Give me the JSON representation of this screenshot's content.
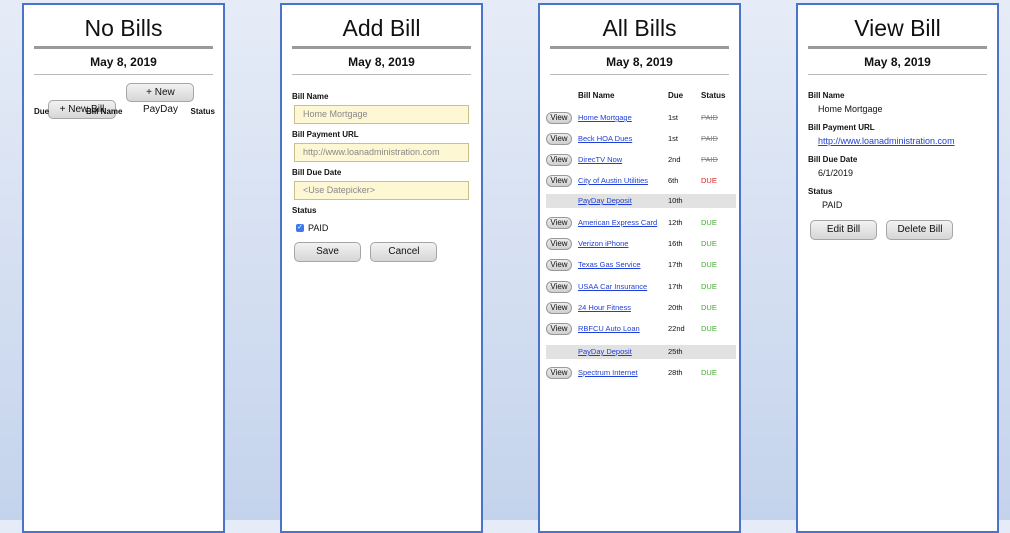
{
  "p1": {
    "title": "No Bills",
    "date": "May 8, 2019",
    "new_bill": "+ New Bill",
    "new_payday": "+ New PayDay",
    "cols": {
      "due": "Due",
      "name": "Bill Name",
      "status": "Status"
    }
  },
  "p2": {
    "title": "Add Bill",
    "date": "May 8, 2019",
    "name_label": "Bill Name",
    "name_placeholder": "Home Mortgage",
    "url_label": "Bill Payment URL",
    "url_placeholder": "http://www.loanadministration.com",
    "due_label": "Bill Due Date",
    "due_placeholder": "<Use Datepicker>",
    "status_label": "Status",
    "paid_label": "PAID",
    "paid_checked": true,
    "save": "Save",
    "cancel": "Cancel"
  },
  "p3": {
    "title": "All Bills",
    "date": "May 8, 2019",
    "cols": {
      "name": "Bill Name",
      "due": "Due",
      "status": "Status"
    },
    "view_label": "View",
    "rows": [
      {
        "name": "Home Mortgage",
        "due": "1st",
        "status": "PAID",
        "kind": "bill",
        "style": "paid"
      },
      {
        "name": "Beck HOA Dues",
        "due": "1st",
        "status": "PAID",
        "kind": "bill",
        "style": "paid"
      },
      {
        "name": "DirecTV Now",
        "due": "2nd",
        "status": "PAID",
        "kind": "bill",
        "style": "paid"
      },
      {
        "name": "City of Austin Utilities",
        "due": "6th",
        "status": "DUE",
        "kind": "bill",
        "style": "due-red"
      },
      {
        "name": "PayDay Deposit",
        "due": "10th",
        "status": "",
        "kind": "payday",
        "style": ""
      },
      {
        "name": "American Express Card",
        "due": "12th",
        "status": "DUE",
        "kind": "bill",
        "style": "due-green"
      },
      {
        "name": "Verizon iPhone",
        "due": "16th",
        "status": "DUE",
        "kind": "bill",
        "style": "due-green"
      },
      {
        "name": "Texas Gas Service",
        "due": "17th",
        "status": "DUE",
        "kind": "bill",
        "style": "due-green"
      },
      {
        "name": "USAA Car Insurance",
        "due": "17th",
        "status": "DUE",
        "kind": "bill",
        "style": "due-green"
      },
      {
        "name": "24 Hour Fitness",
        "due": "20th",
        "status": "DUE",
        "kind": "bill",
        "style": "due-green"
      },
      {
        "name": "RBFCU Auto Loan",
        "due": "22nd",
        "status": "DUE",
        "kind": "bill",
        "style": "due-green"
      },
      {
        "name": "PayDay Deposit",
        "due": "25th",
        "status": "",
        "kind": "payday",
        "style": ""
      },
      {
        "name": "Spectrum Internet",
        "due": "28th",
        "status": "DUE",
        "kind": "bill",
        "style": "due-green"
      }
    ]
  },
  "p4": {
    "title": "View Bill",
    "date": "May 8, 2019",
    "name_label": "Bill Name",
    "name_value": "Home Mortgage",
    "url_label": "Bill Payment URL",
    "url_value": "http://www.loanadministration.com",
    "due_label": "Bill Due Date",
    "due_value": "6/1/2019",
    "status_label": "Status",
    "status_value": "PAID",
    "edit": "Edit Bill",
    "delete": "Delete Bill"
  }
}
